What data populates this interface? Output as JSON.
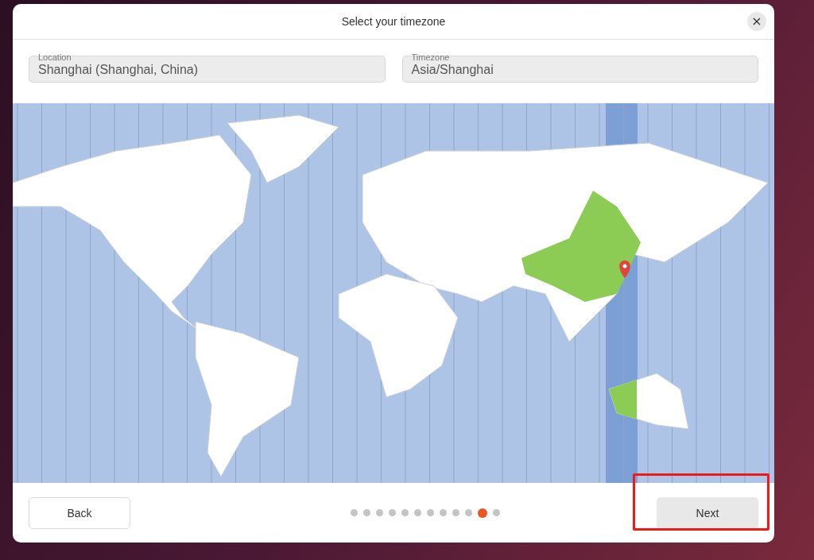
{
  "window": {
    "title": "Select your timezone",
    "close": "×"
  },
  "fields": [
    {
      "label": "Location",
      "value": "Shanghai (Shanghai, China)"
    },
    {
      "label": "Timezone",
      "value": "Asia/Shanghai"
    }
  ],
  "footer": {
    "back": {
      "label": "Back"
    },
    "pages": [
      {
        "selected": false
      },
      {
        "selected": false
      },
      {
        "selected": false
      },
      {
        "selected": false
      },
      {
        "selected": false
      },
      {
        "selected": false
      },
      {
        "selected": false
      },
      {
        "selected": false
      },
      {
        "selected": false
      },
      {
        "selected": false
      },
      {
        "selected": true
      },
      {
        "selected": false
      }
    ],
    "next": {
      "label": "Next",
      "highlighted": true
    }
  }
}
